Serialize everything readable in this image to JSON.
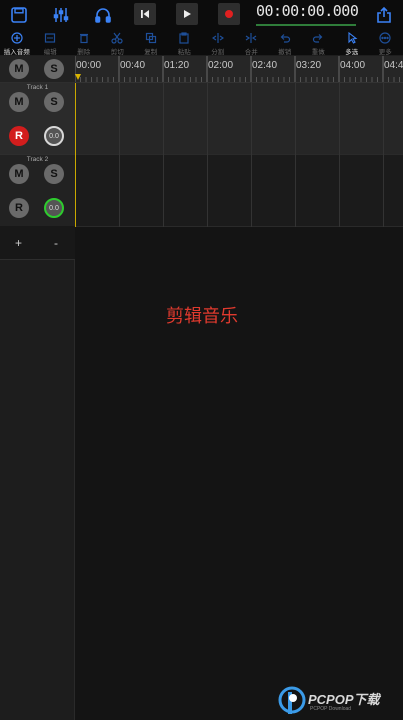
{
  "topbar": {
    "icons": [
      "save-icon",
      "mixer-icon",
      "headphones-icon",
      "skip-back-icon",
      "play-icon",
      "record-icon",
      "share-icon"
    ],
    "timecode": "00:00:00.000",
    "accent": "#2f7d3a"
  },
  "toolbar": {
    "items": [
      {
        "label": "插入音频",
        "icon": "insert-audio-icon"
      },
      {
        "label": "编辑",
        "icon": "edit-icon"
      },
      {
        "label": "删除",
        "icon": "trash-icon"
      },
      {
        "label": "剪切",
        "icon": "scissors-icon"
      },
      {
        "label": "复制",
        "icon": "copy-icon"
      },
      {
        "label": "粘贴",
        "icon": "paste-icon"
      },
      {
        "label": "分割",
        "icon": "split-icon"
      },
      {
        "label": "合并",
        "icon": "merge-icon"
      },
      {
        "label": "撤销",
        "icon": "undo-icon"
      },
      {
        "label": "重做",
        "icon": "redo-icon"
      },
      {
        "label": "多选",
        "icon": "cursor-icon"
      },
      {
        "label": "更多",
        "icon": "more-icon"
      }
    ]
  },
  "master": {
    "mute": "M",
    "solo": "S"
  },
  "tracks": [
    {
      "name": "Track 1",
      "mute": "M",
      "solo": "S",
      "rec": "R",
      "volume": "0.0"
    },
    {
      "name": "Track 2",
      "mute": "M",
      "solo": "S",
      "rec": "R",
      "volume": "0.0"
    }
  ],
  "track_controls": {
    "add": "+",
    "remove": "-"
  },
  "ruler": {
    "labels": [
      "00:00",
      "00:40",
      "01:20",
      "02:00",
      "02:40",
      "03:20",
      "04:00",
      "04:4"
    ]
  },
  "overlay": {
    "text": "剪辑音乐",
    "color": "#e03a2e"
  },
  "watermark": {
    "text": "PCPOP下载",
    "sub": "PCPOP Download"
  }
}
